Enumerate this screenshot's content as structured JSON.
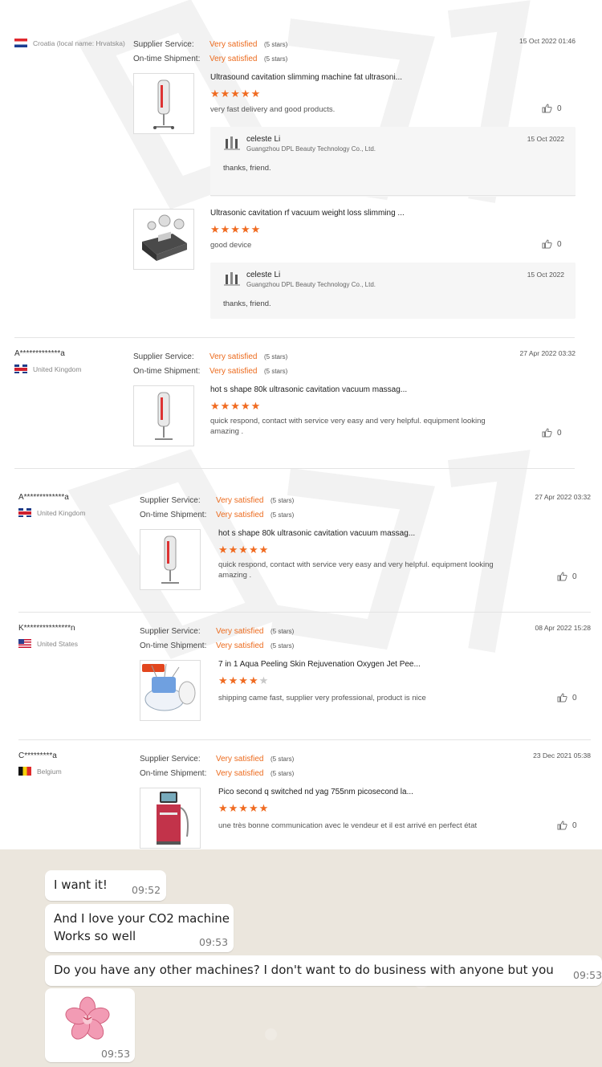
{
  "labels": {
    "supplier_service": "Supplier Service:",
    "ontime_shipment": "On-time Shipment:",
    "very_satisfied": "Very satisfied",
    "five_stars": "(5 stars)"
  },
  "reviews": [
    {
      "reviewer": "",
      "country": "Croatia (local name: Hrvatska)",
      "date": "15 Oct 2022 01:46",
      "products": [
        {
          "title": "Ultrasound cavitation slimming machine fat ultrasoni...",
          "rating": 5,
          "text": "very fast delivery and good products.",
          "likes": "0",
          "reply": {
            "name": "celeste Li",
            "company": "Guangzhou DPL Beauty Technology Co., Ltd.",
            "date": "15 Oct 2022",
            "message": "thanks, friend."
          }
        },
        {
          "title": "Ultrasonic cavitation rf vacuum weight loss slimming ...",
          "rating": 5,
          "text": "good device",
          "likes": "0",
          "reply": {
            "name": "celeste Li",
            "company": "Guangzhou DPL Beauty Technology Co., Ltd.",
            "date": "15 Oct 2022",
            "message": "thanks, friend."
          }
        }
      ]
    },
    {
      "reviewer": "A*************a",
      "country": "United Kingdom",
      "date": "27 Apr 2022 03:32",
      "products": [
        {
          "title": "hot s shape 80k ultrasonic cavitation vacuum massag...",
          "rating": 5,
          "text": "quick respond, contact with service very easy and very helpful. equipment looking amazing .",
          "likes": "0"
        }
      ]
    },
    {
      "reviewer": "A*************a",
      "country": "United Kingdom",
      "date": "27 Apr 2022 03:32",
      "products": [
        {
          "title": "hot s shape 80k ultrasonic cavitation vacuum massag...",
          "rating": 5,
          "text": "quick respond, contact with service very easy and very helpful. equipment looking amazing .",
          "likes": "0"
        }
      ]
    },
    {
      "reviewer": "K***************n",
      "country": "United States",
      "date": "08 Apr 2022 15:28",
      "products": [
        {
          "title": "7 in 1 Aqua Peeling Skin Rejuvenation Oxygen Jet Pee...",
          "rating": 4,
          "text": "shipping came fast, supplier very professional, product is nice",
          "likes": "0"
        }
      ]
    },
    {
      "reviewer": "C*********a",
      "country": "Belgium",
      "date": "23 Dec 2021 05:38",
      "products": [
        {
          "title": "Pico second q switched nd yag 755nm picosecond la...",
          "rating": 5,
          "text": "une très bonne communication avec le vendeur et il est arrivé en perfect état",
          "likes": "0"
        }
      ]
    }
  ],
  "chat": {
    "messages": [
      {
        "lines": [
          "I want it!"
        ],
        "time": "09:52"
      },
      {
        "lines": [
          "And I love your CO2 machine",
          "Works so well"
        ],
        "time": "09:53"
      },
      {
        "lines": [
          "Do you have any other machines? I don't want to do business with anyone but you"
        ],
        "time": "09:53"
      },
      {
        "sticker": "cherry-blossom-sticker",
        "time": "09:53"
      }
    ]
  },
  "colors": {
    "accent": "#f06b21",
    "satisfied": "#ec6b1e",
    "chat_bg": "#ebe6dd"
  }
}
